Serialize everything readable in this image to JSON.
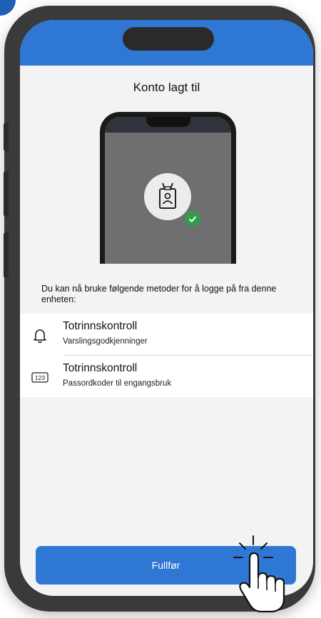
{
  "screen": {
    "title": "Konto lagt til",
    "instruction": "Du kan nå bruke følgende metoder for å logge på fra denne enheten:",
    "methods": [
      {
        "title": "Totrinnskontroll",
        "subtitle": "Varslingsgodkjenninger",
        "icon": "bell-icon"
      },
      {
        "title": "Totrinnskontroll",
        "subtitle": "Passordkoder til engangsbruk",
        "icon": "numeric-code-icon",
        "icon_text": "123"
      }
    ],
    "finish_button": "Fullfør"
  },
  "colors": {
    "accent": "#2f77d4",
    "phone_frame": "#3a3a3c",
    "screen_bg": "#f3f3f3",
    "success": "#2e9e4a"
  },
  "cursor": {
    "icon": "hand-pointer-icon"
  }
}
